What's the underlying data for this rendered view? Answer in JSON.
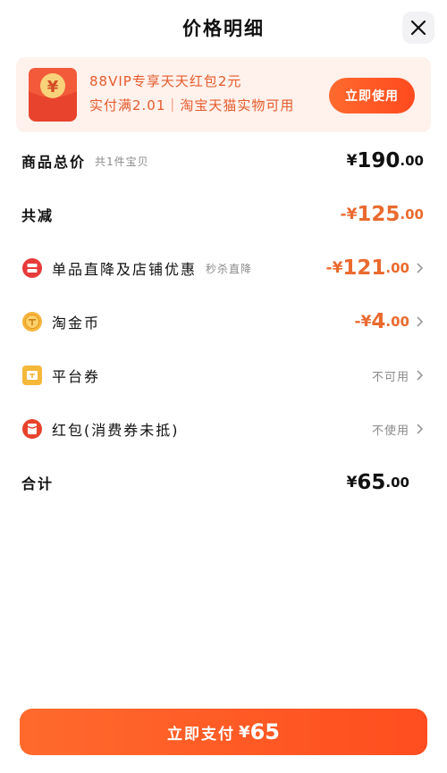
{
  "header": {
    "title": "价格明细"
  },
  "promo": {
    "envelope_symbol": "¥",
    "line1": "88VIP专享天天红包2元",
    "line2": "实付满2.01｜淘宝天猫实物可用",
    "button_label": "立即使用"
  },
  "rows": {
    "goods_total": {
      "label": "商品总价",
      "sub": "共1件宝贝",
      "symbol": "¥",
      "int": "190",
      "dec": ".00"
    },
    "total_discount": {
      "label": "共减",
      "symbol": "-¥",
      "int": "125",
      "dec": ".00"
    },
    "item_discount": {
      "label": "单品直降及店铺优惠",
      "sub": "秒杀直降",
      "symbol": "-¥",
      "int": "121",
      "dec": ".00"
    },
    "gold_coin": {
      "label": "淘金币",
      "symbol": "-¥",
      "int": "4",
      "dec": ".00"
    },
    "platform_coupon": {
      "label": "平台券",
      "value": "不可用"
    },
    "red_packet": {
      "label": "红包(消费券未抵)",
      "value": "不使用"
    },
    "total": {
      "label": "合计",
      "symbol": "¥",
      "int": "65",
      "dec": ".00"
    }
  },
  "pay": {
    "label": "立即支付",
    "symbol": "¥",
    "amount": "65"
  },
  "colors": {
    "accent": "#ff5a24",
    "price_orange": "#ea6a2f",
    "promo_bg": "#fff1ec",
    "item_icon_red": "#e83a3a",
    "coin_yellow": "#f6b33c",
    "coupon_yellow": "#f5b83a"
  },
  "icons": {
    "close": "close-icon",
    "envelope": "red-envelope-icon",
    "item_discount": "discount-icon",
    "gold_coin": "gold-coin-icon",
    "platform_coupon": "coupon-icon",
    "red_packet": "red-packet-icon",
    "chevron": "chevron-right-icon"
  }
}
